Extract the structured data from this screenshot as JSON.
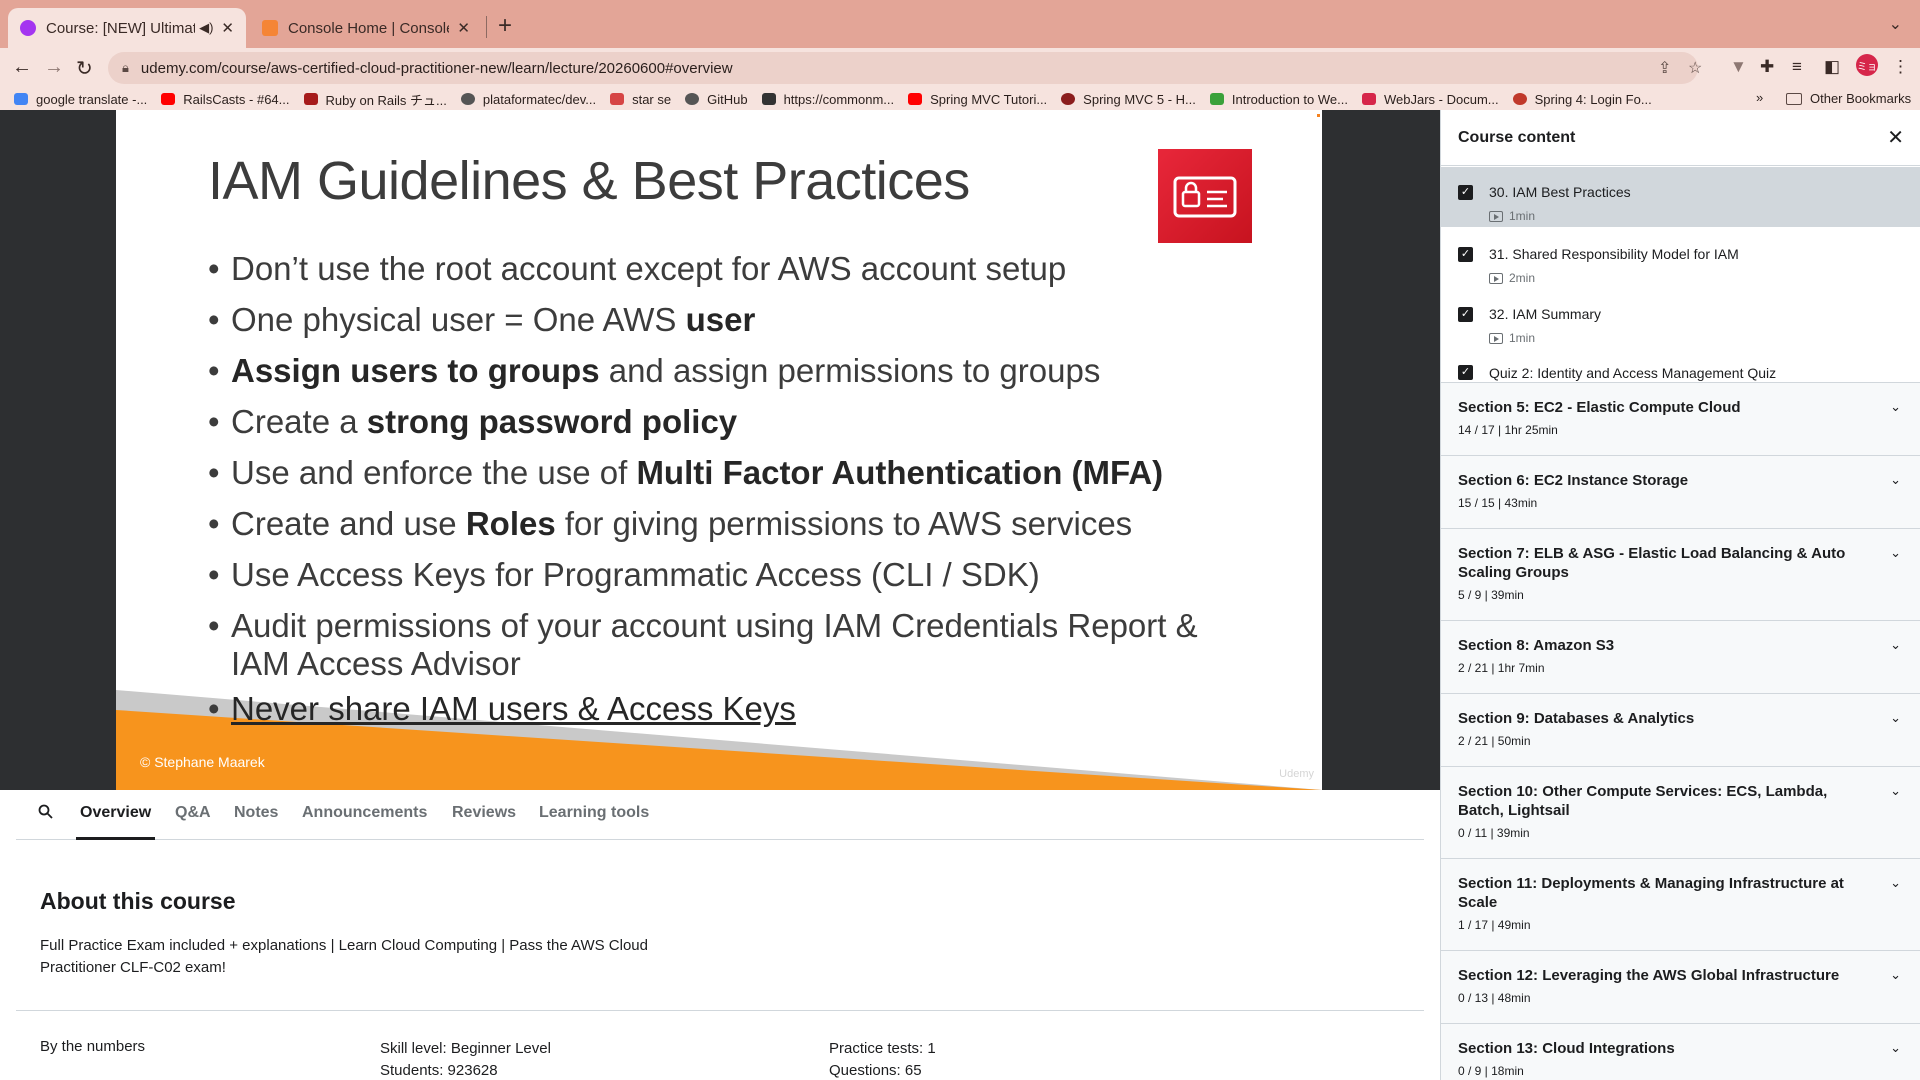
{
  "browser": {
    "tabs": [
      {
        "title": "Course: [NEW] Ultimate AW",
        "favicon_color": "#a435f0"
      },
      {
        "title": "Console Home | Console Home",
        "favicon_color": "#f58536"
      }
    ],
    "url": "udemy.com/course/aws-certified-cloud-practitioner-new/learn/lecture/20260600#overview",
    "bookmarks": [
      {
        "label": "google translate -...",
        "color": "#4285f4"
      },
      {
        "label": "RailsCasts - #64...",
        "color": "#ff0000"
      },
      {
        "label": "Ruby on Rails チュ...",
        "color": "#a61b1b"
      },
      {
        "label": "plataformatec/dev...",
        "color": "#555555"
      },
      {
        "label": "star se",
        "color": "#d64545"
      },
      {
        "label": "GitHub",
        "color": "#555555"
      },
      {
        "label": "https://commonm...",
        "color": "#333333"
      },
      {
        "label": "Spring MVC Tutori...",
        "color": "#ff0000"
      },
      {
        "label": "Spring MVC 5 - H...",
        "color": "#8b1d1d"
      },
      {
        "label": "Introduction to We...",
        "color": "#3aa13a"
      },
      {
        "label": "WebJars - Docum...",
        "color": "#d6264a"
      },
      {
        "label": "Spring 4: Login Fo...",
        "color": "#c0392b"
      }
    ],
    "bookmarks_more": "»",
    "other_bookmarks": "Other Bookmarks",
    "profile_initials": "ミョ"
  },
  "slide": {
    "title": "IAM Guidelines & Best Practices",
    "bullets": [
      {
        "pre": "Don’t use the root account except for AWS account setup",
        "bold": "",
        "post": ""
      },
      {
        "pre": "One physical user = One AWS ",
        "bold": "user",
        "post": ""
      },
      {
        "pre": "",
        "bold": "Assign users to groups",
        "post": " and assign permissions to groups"
      },
      {
        "pre": "Create a ",
        "bold": "strong password policy",
        "post": ""
      },
      {
        "pre": "Use and enforce the use of ",
        "bold": "Multi Factor Authentication (MFA)",
        "post": ""
      },
      {
        "pre": "Create and use ",
        "bold": "Roles",
        "post": " for giving permissions to AWS services"
      },
      {
        "pre": "Use Access Keys for Programmatic Access (CLI / SDK)",
        "bold": "",
        "post": ""
      },
      {
        "pre": "Audit permissions of your account using IAM Credentials Report & IAM Access Advisor",
        "bold": "",
        "post": ""
      }
    ],
    "last_bullet": "Never share IAM users & Access Keys",
    "copyright": "© Stephane Maarek",
    "watermark": "Udemy",
    "accent_color": "#f7941d"
  },
  "course_nav": {
    "tabs": [
      "Overview",
      "Q&A",
      "Notes",
      "Announcements",
      "Reviews",
      "Learning tools"
    ],
    "active": "Overview"
  },
  "about": {
    "title": "About this course",
    "description": "Full Practice Exam included + explanations | Learn Cloud Computing | Pass the AWS Cloud Practitioner CLF-C02 exam!",
    "numbers_label": "By the numbers",
    "skill_level": "Skill level: Beginner Level",
    "students": "Students: 923628",
    "practice_tests": "Practice tests: 1",
    "questions": "Questions: 65"
  },
  "sidebar": {
    "title": "Course content",
    "lectures": [
      {
        "title": "30. IAM Best Practices",
        "duration": "1min",
        "current": true,
        "has_duration": true
      },
      {
        "title": "31. Shared Responsibility Model for IAM",
        "duration": "2min",
        "current": false,
        "has_duration": true
      },
      {
        "title": "32. IAM Summary",
        "duration": "1min",
        "current": false,
        "has_duration": true
      },
      {
        "title": "Quiz 2: Identity and Access Management Quiz",
        "duration": "",
        "current": false,
        "has_duration": false
      }
    ],
    "sections": [
      {
        "title": "Section 5: EC2 - Elastic Compute Cloud",
        "meta": "14 / 17 | 1hr 25min"
      },
      {
        "title": "Section 6: EC2 Instance Storage",
        "meta": "15 / 15 | 43min"
      },
      {
        "title": "Section 7: ELB & ASG - Elastic Load Balancing & Auto Scaling Groups",
        "meta": "5 / 9 | 39min"
      },
      {
        "title": "Section 8: Amazon S3",
        "meta": "2 / 21 | 1hr 7min"
      },
      {
        "title": "Section 9: Databases & Analytics",
        "meta": "2 / 21 | 50min"
      },
      {
        "title": "Section 10: Other Compute Services: ECS, Lambda, Batch, Lightsail",
        "meta": "0 / 11 | 39min"
      },
      {
        "title": "Section 11: Deployments & Managing Infrastructure at Scale",
        "meta": "1 / 17 | 49min"
      },
      {
        "title": "Section 12: Leveraging the AWS Global Infrastructure",
        "meta": "0 / 13 | 48min"
      },
      {
        "title": "Section 13: Cloud Integrations",
        "meta": "0 / 9 | 18min"
      }
    ]
  }
}
